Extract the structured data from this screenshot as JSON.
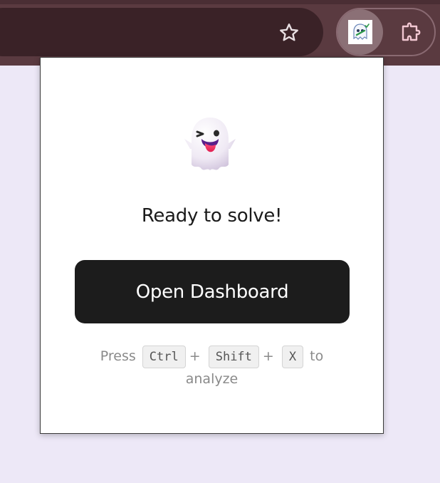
{
  "browser": {
    "star_icon": "star-outline-icon",
    "extension_icon": "ghost-extension-icon",
    "puzzle_icon": "puzzle-piece-icon"
  },
  "popup": {
    "hero_icon": "winking-ghost-icon",
    "title": "Ready to solve!",
    "dashboard_button_label": "Open Dashboard",
    "hint": {
      "press": "Press",
      "key1": "Ctrl",
      "plus1": "+",
      "key2": "Shift",
      "plus2": "+",
      "key3": "X",
      "to": "to",
      "action": "analyze"
    }
  },
  "colors": {
    "toolbar_bg": "#5a3a40",
    "omnibox_bg": "#3a2227",
    "page_bg": "#ede8f7",
    "button_bg": "#1c1c1c",
    "hint_text": "#8a8a8a"
  }
}
